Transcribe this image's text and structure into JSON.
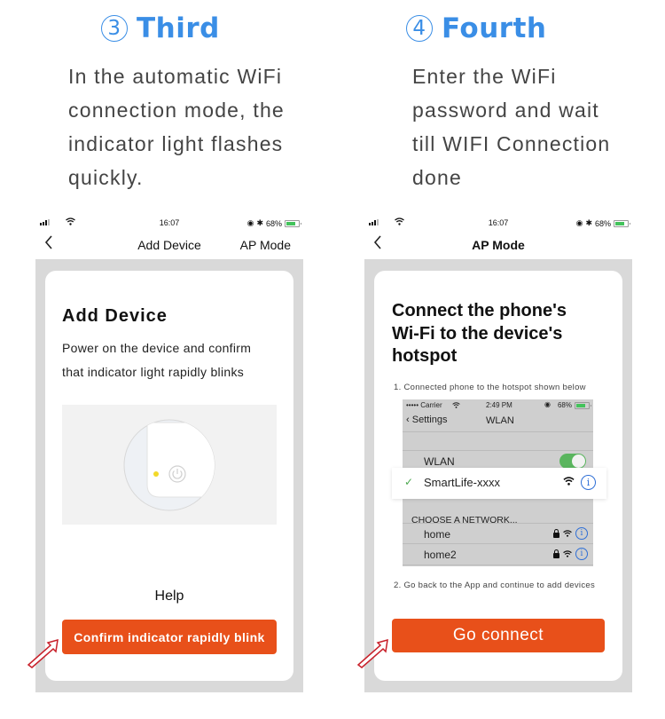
{
  "steps": [
    {
      "number": "3",
      "title": "Third",
      "description_lines": [
        "In the automatic WiFi",
        "connection mode, the",
        "indicator light flashes",
        "quickly."
      ]
    },
    {
      "number": "4",
      "title": "Fourth",
      "description_lines": [
        "Enter the WiFi",
        "password and wait",
        "till WIFI Connection",
        "done"
      ]
    }
  ],
  "phone1": {
    "status": {
      "time": "16:07",
      "battery": "68%",
      "battery_level": 0.68
    },
    "nav": {
      "back_icon": "chevron-left-icon",
      "title": "Add Device",
      "right_action": "AP Mode"
    },
    "card": {
      "title": "Add Device",
      "desc_lines": [
        "Power on the device and confirm",
        "that indicator light rapidly blinks"
      ],
      "indicator_color": "#f2d92a",
      "help_label": "Help",
      "button_label": "Confirm indicator rapidly blink"
    }
  },
  "phone2": {
    "status": {
      "time": "16:07",
      "battery": "68%",
      "battery_level": 0.68
    },
    "nav": {
      "back_icon": "chevron-left-icon",
      "title": "AP Mode"
    },
    "card": {
      "title_lines": [
        "Connect the phone's",
        "Wi-Fi to the device's",
        "hotspot"
      ],
      "step1": "1. Connected phone to the hotspot shown below",
      "step2": "2. Go back to the App and continue to add devices",
      "button_label": "Go connect",
      "ios_screen": {
        "carrier": "••••• Carrier",
        "time": "2:49 PM",
        "battery": "68%",
        "back_label": "Settings",
        "title": "WLAN",
        "wlan_label": "WLAN",
        "wlan_on": true,
        "connected_network": "SmartLife-xxxx",
        "choose_label": "CHOOSE A NETWORK...",
        "networks": [
          "home",
          "home2"
        ]
      }
    }
  },
  "colors": {
    "accent_blue": "#3a8ee6",
    "button_orange": "#e8501a",
    "toggle_green": "#5ab55e",
    "arrow_red": "#c8202a"
  }
}
